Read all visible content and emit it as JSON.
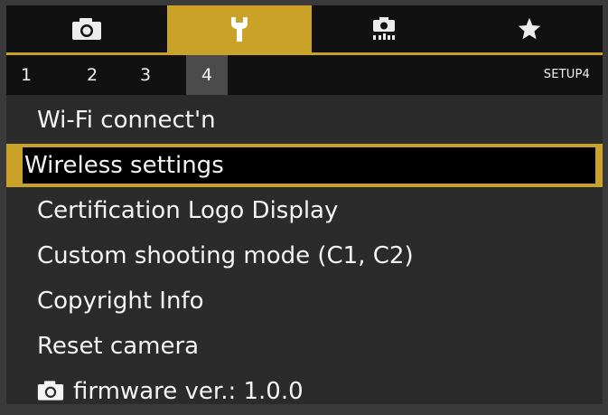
{
  "tabs": [
    {
      "icon": "camera-icon",
      "active": false
    },
    {
      "icon": "wrench-icon",
      "active": true
    },
    {
      "icon": "custom-function-icon",
      "active": false
    },
    {
      "icon": "star-icon",
      "active": false
    }
  ],
  "pages": {
    "numbers": [
      "1",
      "2",
      "3",
      "4"
    ],
    "active": "4",
    "title": "SETUP4"
  },
  "menu": {
    "items": [
      {
        "label": "Wi-Fi connect'n"
      },
      {
        "label": "Wireless settings",
        "selected": true
      },
      {
        "label": "Certification Logo Display"
      },
      {
        "label": "Custom shooting mode (C1, C2)"
      },
      {
        "label": "Copyright Info"
      },
      {
        "label": "Reset camera"
      },
      {
        "label": "firmware ver.: 1.0.0",
        "icon": "camera-icon"
      }
    ]
  },
  "colors": {
    "accent": "#c9a227",
    "background": "#2b2b2b",
    "bar": "#111111"
  }
}
